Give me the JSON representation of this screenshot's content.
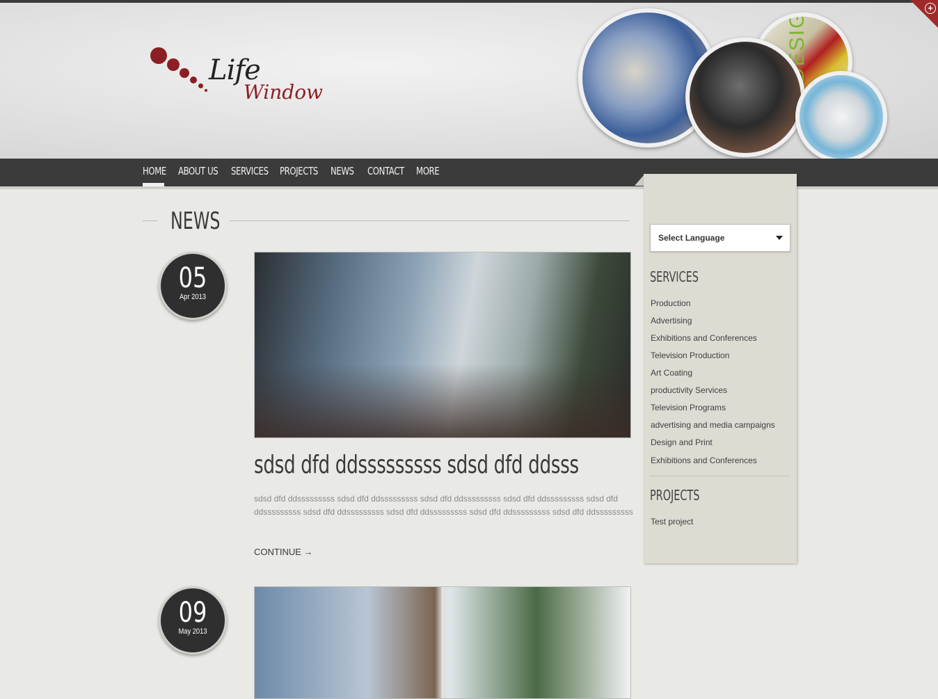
{
  "logo": {
    "word1": "Life",
    "word2": "Window"
  },
  "nav": {
    "items": [
      "HOME",
      "ABOUT US",
      "SERVICES",
      "PROJECTS",
      "NEWS",
      "CONTACT",
      "MORE"
    ],
    "active": "HOME"
  },
  "page": {
    "title": "NEWS"
  },
  "posts": [
    {
      "day": "05",
      "month": "Apr 2013",
      "title": "sdsd dfd ddsssssssss sdsd dfd ddsss",
      "body": "sdsd dfd ddsssssssss sdsd dfd ddsssssssss sdsd dfd ddsssssssss sdsd dfd ddsssssssss sdsd dfd ddsssssssss sdsd dfd ddsssssssss sdsd dfd ddsssssssss sdsd dfd ddsssssssss sdsd dfd ddsssssssss",
      "continue_label": "CONTINUE →"
    },
    {
      "day": "09",
      "month": "May 2013"
    }
  ],
  "sidebar": {
    "language_label": "Select Language",
    "services_heading": "SERVICES",
    "services": [
      "Production",
      "Advertising",
      "Exhibitions and Conferences",
      "Television Production",
      "Art Coating",
      "productivity Services",
      "Television Programs",
      "advertising and media campaigns",
      "Design and Print",
      "Exhibitions and Conferences"
    ],
    "projects_heading": "PROJECTS",
    "projects": [
      "Test project"
    ]
  },
  "header_images": {
    "design_label": "DESIGN"
  },
  "colors": {
    "brand": "#8b1f24",
    "nav_bg": "#3b3b3b",
    "page_bg": "#e9e9e5",
    "sidebar_bg": "#dedbd3"
  }
}
